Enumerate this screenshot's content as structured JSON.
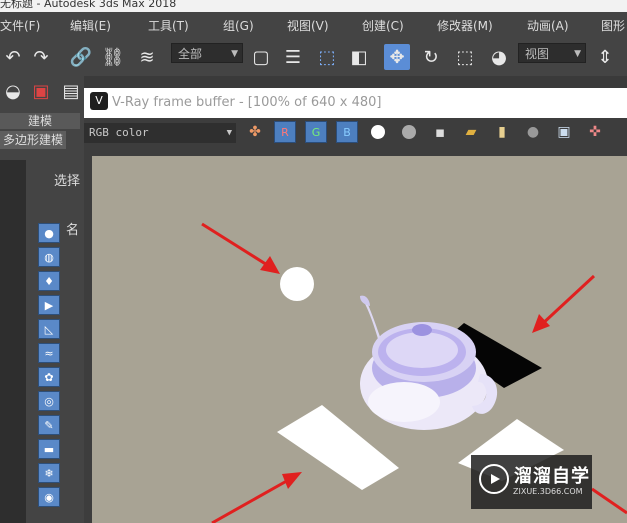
{
  "app": {
    "title": "无标题 - Autodesk 3ds Max 2018"
  },
  "menu": {
    "items": [
      {
        "label": "文件(F)"
      },
      {
        "label": "编辑(E)"
      },
      {
        "label": "工具(T)"
      },
      {
        "label": "组(G)"
      },
      {
        "label": "视图(V)"
      },
      {
        "label": "创建(C)"
      },
      {
        "label": "修改器(M)"
      },
      {
        "label": "动画(A)"
      },
      {
        "label": "图形"
      }
    ]
  },
  "toolbar": {
    "selection_filter": "全部",
    "view_dropdown": "视图"
  },
  "left_panel": {
    "tab_modeling": "建模",
    "tab_poly": "多边形建模",
    "select_label": "选择",
    "name_label": "名"
  },
  "vray": {
    "window_title": "V-Ray frame buffer - [100% of 640 x 480]",
    "channel": "RGB color",
    "r_label": "R",
    "g_label": "G",
    "b_label": "B"
  },
  "watermark": {
    "title": "溜溜自学",
    "subtitle": "ZIXUE.3D66.COM"
  },
  "colors": {
    "accent": "#5b8dd6",
    "render_background": "#a8a394",
    "arrow": "#e0201f"
  }
}
